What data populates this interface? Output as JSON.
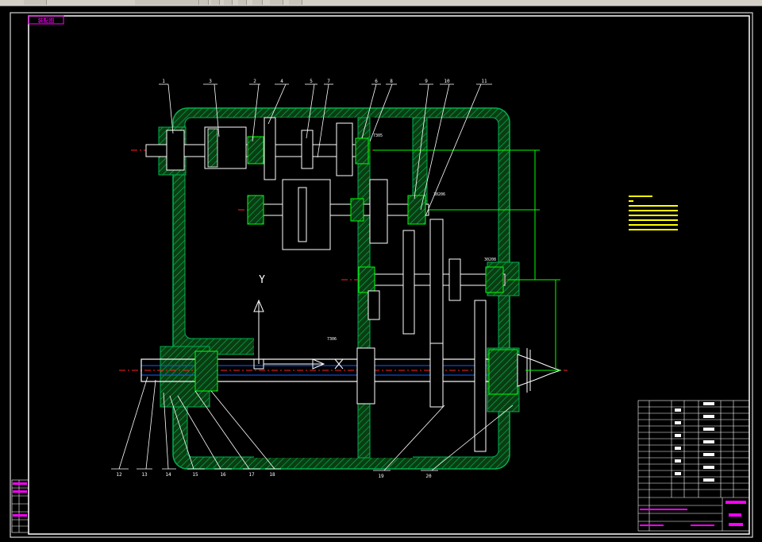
{
  "toolbar": {
    "buttons": [
      "toolbar-button-1",
      "toolbar-button-2",
      "toolbar-button-3",
      "toolbar-button-4",
      "toolbar-button-5",
      "toolbar-button-6",
      "toolbar-button-7",
      "toolbar-button-8",
      "toolbar-button-9"
    ]
  },
  "drawing": {
    "frame_tag": "装配图",
    "axis_label": "Y",
    "callouts_top": [
      "1",
      "3",
      "2",
      "4",
      "5",
      "7",
      "6",
      "8",
      "9",
      "10",
      "11"
    ],
    "callouts_bottom": [
      "12",
      "13",
      "14",
      "15",
      "16",
      "17",
      "18",
      "19",
      "20"
    ],
    "bearing_labels": [
      "7305",
      "30206",
      "7306",
      "30208"
    ],
    "colors": {
      "background": "#000000",
      "housing": "#2e7d32",
      "hatch": "#00b050",
      "part": "#ffffff",
      "centerline": "#ff2020",
      "axis": "#1060ff",
      "dimension": "#00ff00",
      "leader": "#ffffff",
      "title": "#ff00ff",
      "note": "#ffff00"
    }
  }
}
